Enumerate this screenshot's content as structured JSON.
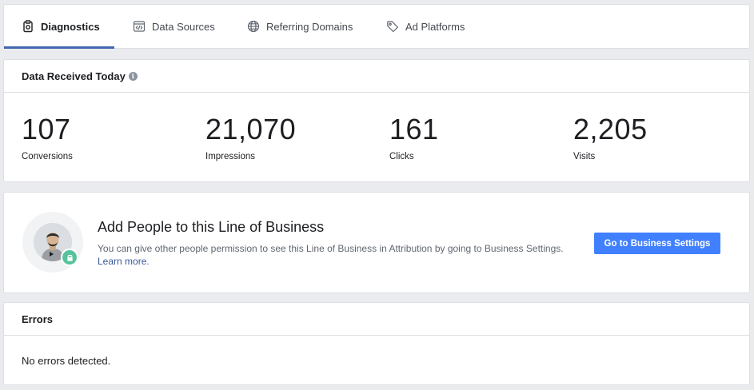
{
  "tabs": [
    {
      "label": "Diagnostics",
      "icon": "diagnostics-icon",
      "active": true
    },
    {
      "label": "Data Sources",
      "icon": "code-icon",
      "active": false
    },
    {
      "label": "Referring Domains",
      "icon": "globe-icon",
      "active": false
    },
    {
      "label": "Ad Platforms",
      "icon": "tag-icon",
      "active": false
    }
  ],
  "data_received": {
    "title": "Data Received Today",
    "info_icon": "info-icon",
    "metrics": [
      {
        "value": "107",
        "label": "Conversions"
      },
      {
        "value": "21,070",
        "label": "Impressions"
      },
      {
        "value": "161",
        "label": "Clicks"
      },
      {
        "value": "2,205",
        "label": "Visits"
      }
    ]
  },
  "add_people": {
    "title": "Add People to this Line of Business",
    "description": "You can give other people permission to see this Line of Business in Attribution by going to Business Settings.",
    "learn_more": "Learn more.",
    "button_label": "Go to Business Settings"
  },
  "errors": {
    "title": "Errors",
    "message": "No errors detected."
  },
  "colors": {
    "accent": "#4267b2",
    "button": "#4080ff",
    "lock_badge": "#57c29b",
    "link": "#385898"
  }
}
